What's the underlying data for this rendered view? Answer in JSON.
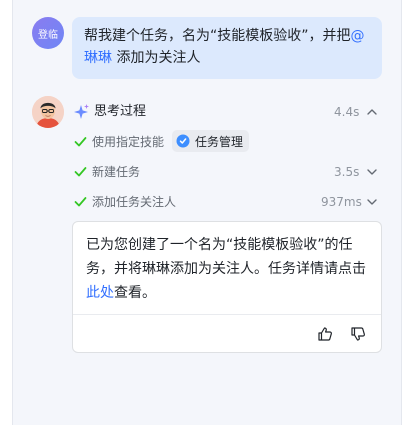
{
  "user": {
    "avatar_label": "登临"
  },
  "user_message": {
    "text_before": "帮我建个任务，名为“技能模板验收”，并把",
    "mention": "@琳琳",
    "text_after": " 添加为关注人"
  },
  "thinking": {
    "title": "思考过程",
    "time": "4.4s",
    "expanded": true
  },
  "steps": [
    {
      "label": "使用指定技能",
      "skill": "任务管理",
      "status": "done"
    },
    {
      "label": "新建任务",
      "time": "3.5s",
      "status": "done"
    },
    {
      "label": "添加任务关注人",
      "time": "937ms",
      "status": "done"
    }
  ],
  "answer": {
    "text": "已为您创建了一个名为“技能模板验收”的任务，并将琳琳添加为关注人。任务详情请点击",
    "link": "此处",
    "text_after": "查看。"
  },
  "colors": {
    "accent": "#3370ff",
    "user_bubble": "#dce9fd",
    "check": "#34c724",
    "panel": "#f4f6fb"
  }
}
